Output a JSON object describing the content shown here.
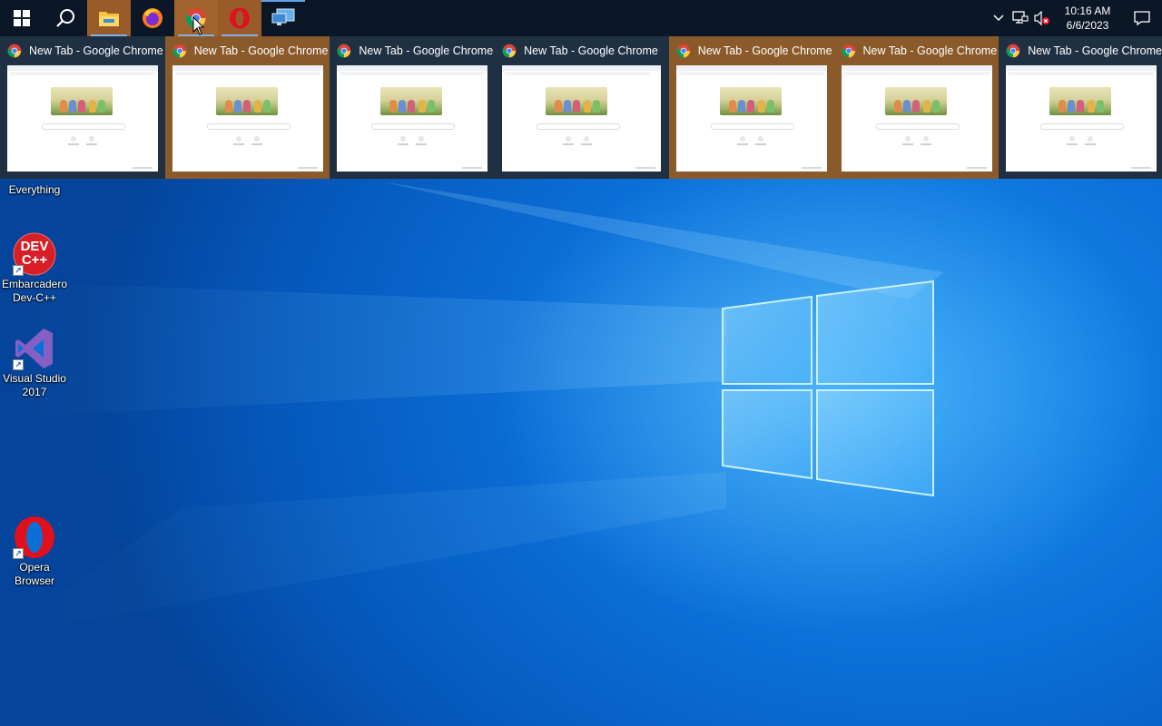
{
  "taskbar": {
    "items": [
      {
        "name": "start-button",
        "icon": "windows-logo-icon"
      },
      {
        "name": "search-button",
        "icon": "search-icon"
      },
      {
        "name": "file-explorer",
        "icon": "folder-icon"
      },
      {
        "name": "firefox",
        "icon": "firefox-icon"
      },
      {
        "name": "google-chrome",
        "icon": "chrome-icon"
      },
      {
        "name": "opera",
        "icon": "opera-icon"
      },
      {
        "name": "remote-desktop",
        "icon": "remote-desktop-icon"
      }
    ],
    "tray": {
      "time": "10:16 AM",
      "date": "6/6/2023",
      "icons": [
        "chevron-up-icon",
        "network-icon",
        "volume-muted-icon",
        "notifications-icon"
      ]
    }
  },
  "previews": [
    {
      "title": "New Tab - Google Chrome",
      "selected": false
    },
    {
      "title": "New Tab - Google Chrome",
      "selected": true
    },
    {
      "title": "New Tab - Google Chrome",
      "selected": false
    },
    {
      "title": "New Tab - Google Chrome",
      "selected": false
    },
    {
      "title": "New Tab - Google Chrome",
      "selected": true
    },
    {
      "title": "New Tab - Google Chrome",
      "selected": true
    },
    {
      "title": "New Tab - Google Chrome",
      "selected": false
    }
  ],
  "desktop_icons": [
    {
      "label": "Everything"
    },
    {
      "label": "Embarcadero Dev-C++",
      "icon_text": "DEV C++"
    },
    {
      "label": "Visual Studio 2017"
    },
    {
      "label": "Opera Browser"
    }
  ],
  "colors": {
    "taskbar_bg": "#0b1626",
    "active_bg": "#9a5b2a",
    "preview_bg": "#203043",
    "preview_selected_bg": "#8b5a2b",
    "wallpaper": "#0b6fd8"
  }
}
